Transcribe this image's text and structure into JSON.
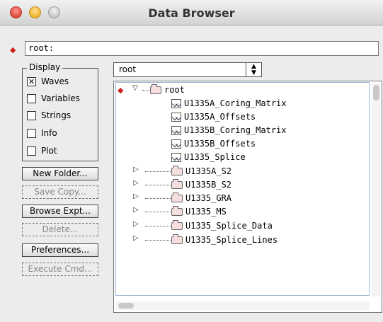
{
  "window": {
    "title": "Data Browser"
  },
  "path": {
    "value": "root:"
  },
  "display": {
    "legend": "Display",
    "options": [
      {
        "label": "Waves",
        "checked": true
      },
      {
        "label": "Variables",
        "checked": false
      },
      {
        "label": "Strings",
        "checked": false
      },
      {
        "label": "Info",
        "checked": false
      },
      {
        "label": "Plot",
        "checked": false
      }
    ]
  },
  "buttons": {
    "new_folder": "New Folder...",
    "save_copy": "Save Copy...",
    "browse_expt": "Browse Expt...",
    "delete": "Delete...",
    "preferences": "Preferences...",
    "execute_cmd": "Execute Cmd..."
  },
  "popup": {
    "selected": "root"
  },
  "tree": {
    "root": "root",
    "waves": [
      "U1335A_Coring_Matrix",
      "U1335A_Offsets",
      "U1335B_Coring_Matrix",
      "U1335B_Offsets",
      "U1335_Splice"
    ],
    "folders": [
      "U1335A_S2",
      "U1335B_S2",
      "U1335_GRA",
      "U1335_MS",
      "U1335_Splice_Data",
      "U1335_Splice_Lines"
    ]
  },
  "icons": {
    "current_marker": "red-arrow-icon",
    "folder": "folder-icon",
    "wave": "wave-icon"
  }
}
